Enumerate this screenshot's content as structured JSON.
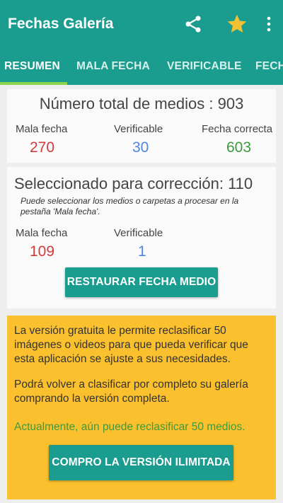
{
  "app": {
    "title": "Fechas Galería",
    "accent": "#1a9d8f",
    "icons": [
      "share-icon",
      "star-icon",
      "more-vert-icon"
    ]
  },
  "tabs": [
    {
      "label": "RESUMEN",
      "active": true
    },
    {
      "label": "MALA FECHA",
      "active": false
    },
    {
      "label": "VERIFICABLE",
      "active": false
    },
    {
      "label": "FECH",
      "active": false
    }
  ],
  "summary": {
    "total_label": "Número total de medios :",
    "total_value": "903",
    "stats": [
      {
        "label": "Mala fecha",
        "value": "270",
        "color": "#d23b3b"
      },
      {
        "label": "Verificable",
        "value": "30",
        "color": "#4f86e2"
      },
      {
        "label": "Fecha correcta",
        "value": "603",
        "color": "#3e9a3f"
      }
    ]
  },
  "selection": {
    "title": "Seleccionado para corrección:",
    "value": "110",
    "hint": "Puede seleccionar los medios o carpetas a procesar en la pestaña 'Mala fecha'.",
    "stats": [
      {
        "label": "Mala fecha",
        "value": "109"
      },
      {
        "label": "Verificable",
        "value": "1"
      }
    ],
    "restore_button": "RESTAURAR FECHA MEDIO"
  },
  "promo": {
    "background": "#fbc02d",
    "text1": "La versión gratuita le permite reclasificar 50 imágenes o videos para que pueda verificar que esta aplicación se ajuste a sus necesidades.",
    "text2": "Podrá volver a clasificar por completo su galería comprando la versión completa.",
    "text3": "Actualmente, aún puede reclasificar 50 medios.",
    "buy_button": "COMPRO LA VERSIÓN ILIMITADA"
  }
}
